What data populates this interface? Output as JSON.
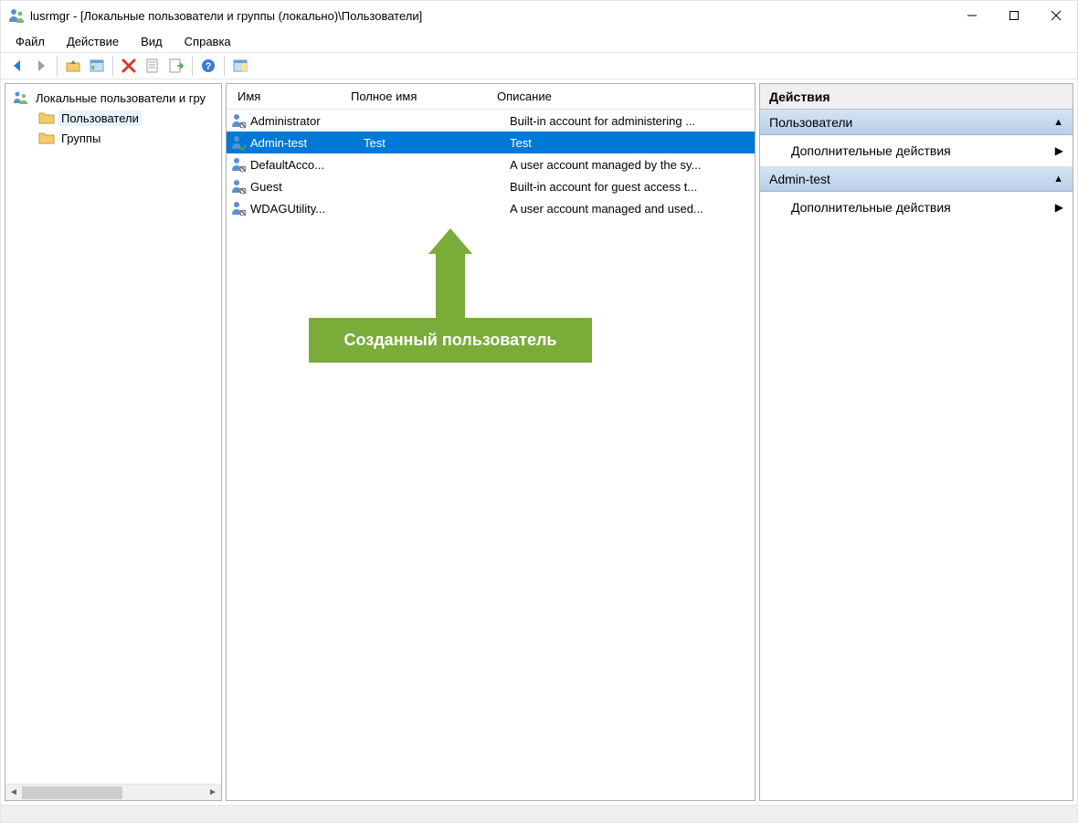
{
  "window": {
    "title": "lusrmgr - [Локальные пользователи и группы (локально)\\Пользователи]"
  },
  "menu": {
    "file": "Файл",
    "action": "Действие",
    "view": "Вид",
    "help": "Справка"
  },
  "tree": {
    "root": "Локальные пользователи и гру",
    "users": "Пользователи",
    "groups": "Группы"
  },
  "columns": {
    "name": "Имя",
    "fullname": "Полное имя",
    "description": "Описание"
  },
  "users": [
    {
      "name": "Administrator",
      "fullname": "",
      "description": "Built-in account for administering ..."
    },
    {
      "name": "Admin-test",
      "fullname": "Test",
      "description": "Test"
    },
    {
      "name": "DefaultAcco...",
      "fullname": "",
      "description": "A user account managed by the sy..."
    },
    {
      "name": "Guest",
      "fullname": "",
      "description": "Built-in account for guest access t..."
    },
    {
      "name": "WDAGUtility...",
      "fullname": "",
      "description": "A user account managed and used..."
    }
  ],
  "selected_user_index": 1,
  "callout": {
    "text": "Созданный пользователь"
  },
  "actions": {
    "title": "Действия",
    "section1": "Пользователи",
    "link1": "Дополнительные действия",
    "section2": "Admin-test",
    "link2": "Дополнительные действия"
  },
  "colors": {
    "selection": "#0078d7",
    "callout": "#7aac3a",
    "actions_header_top": "#d6e5f5",
    "actions_header_bottom": "#b8cee8"
  }
}
